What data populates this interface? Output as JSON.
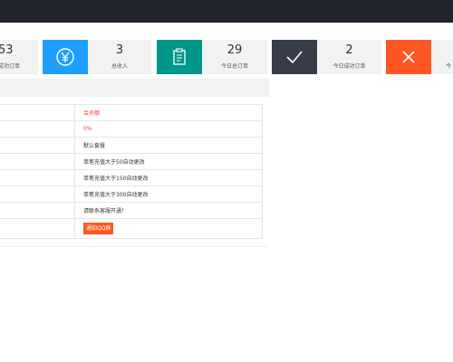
{
  "stats": [
    {
      "value": "53",
      "label": "成功订单",
      "icon": "cart-icon",
      "color": "#f2f2f2"
    },
    {
      "value": "3",
      "label": "总收入",
      "icon": "yen-icon",
      "color": "#1e9fff"
    },
    {
      "value": "29",
      "label": "今日总订单",
      "icon": "clipboard-icon",
      "color": "#009688"
    },
    {
      "value": "2",
      "label": "今日成功订单",
      "icon": "check-icon",
      "color": "#393d49"
    },
    {
      "value": "",
      "label": "今",
      "icon": "close-icon",
      "color": "#ff5722"
    }
  ],
  "info_rows": [
    {
      "value": "会员额",
      "style": "red"
    },
    {
      "value": "0%",
      "style": "red"
    },
    {
      "value": "默认套餐",
      "style": "normal"
    },
    {
      "value": "单笔充值大于50自动更改",
      "style": "normal"
    },
    {
      "value": "单笔充值大于150自动更改",
      "style": "normal"
    },
    {
      "value": "单笔充值大于300自动更改",
      "style": "normal"
    },
    {
      "value": "请联系客服开通！",
      "style": "normal"
    }
  ],
  "qq_button": {
    "label": "通知QQ群"
  }
}
